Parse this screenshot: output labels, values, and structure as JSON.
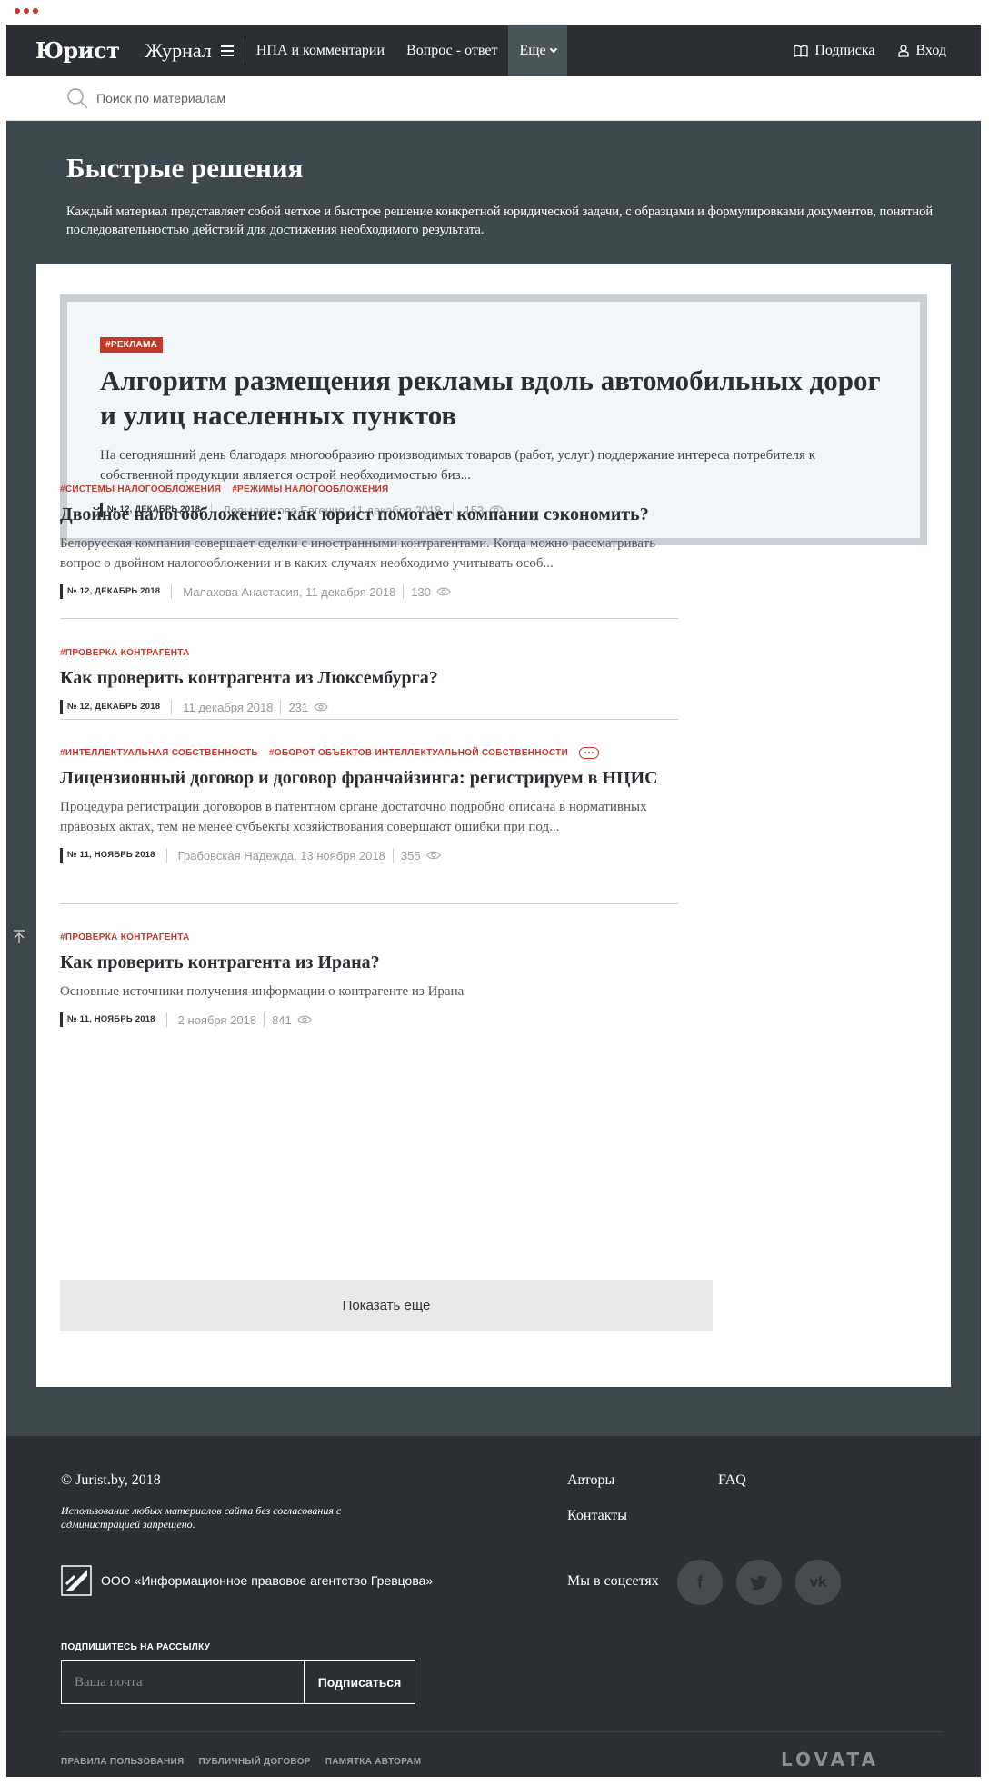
{
  "header": {
    "logo": "Юрист",
    "journal": "Журнал",
    "nav": [
      "НПА и комментарии",
      "Вопрос - ответ"
    ],
    "more": "Еще",
    "subscribe": "Подписка",
    "login": "Вход"
  },
  "search": {
    "placeholder": "Поиск по материалам"
  },
  "hero": {
    "title": "Быстрые решения",
    "description": "Каждый материал представляет собой четкое и быстрое решение конкретной юридической задачи, с образцами и формулировками документов, понятной последовательностью действий для достижения необходимого результата."
  },
  "featured": {
    "tag": "#РЕКЛАМА",
    "title": "Алгоритм размещения рекламы вдоль автомобильных дорог и улиц населенных пунктов",
    "description": "На сегодняшний день благодаря многообразию производимых товаров (работ, услуг) поддержание интереса потребителя к собственной продукции является острой необходимостью биз...",
    "issue": "№ 12, ДЕКАБРЬ 2018",
    "author_date": "Довыденкова Евгения, 11 декабря 2018",
    "views": "153"
  },
  "articles": [
    {
      "tags": [
        "#СИСТЕМЫ НАЛОГООБЛОЖЕНИЯ",
        "#РЕЖИМЫ НАЛОГООБЛОЖЕНИЯ"
      ],
      "title": "Двойное налогообложение: как юрист помогает компании сэкономить?",
      "description": "Белорусская компания совершает сделки с иностранными контрагентами. Когда можно рассматривать вопрос о двойном налогообложении и в каких случаях необходимо учитывать особ...",
      "issue": "№ 12, ДЕКАБРЬ 2018",
      "author_date": "Малахова Анастасия, 11 декабря 2018",
      "views": "130"
    },
    {
      "tags": [
        "#ПРОВЕРКА КОНТРАГЕНТА"
      ],
      "title": "Как проверить контрагента из Люксембурга?",
      "description": "",
      "issue": "№ 12, ДЕКАБРЬ 2018",
      "author_date": "11 декабря 2018",
      "views": "231"
    },
    {
      "tags": [
        "#ИНТЕЛЛЕКТУАЛЬНАЯ СОБСТВЕННОСТЬ",
        "#ОБОРОТ ОБЪЕКТОВ ИНТЕЛЛЕКТУАЛЬНОЙ СОБСТВЕННОСТИ"
      ],
      "title": "Лицензионный договор и договор франчайзинга: регистрируем в НЦИС",
      "description": "Процедура регистрации договоров в патентном органе достаточно подробно описана в нормативных правовых актах, тем не менее субъекты хозяйствования совершают ошибки при под...",
      "issue": "№ 11, НОЯБРЬ 2018",
      "author_date": "Грабовская Надежда, 13 ноября 2018",
      "views": "355"
    },
    {
      "tags": [
        "#ПРОВЕРКА КОНТРАГЕНТА"
      ],
      "title": "Как проверить контрагента из Ирана?",
      "description": "Основные источники получения информации о контрагенте из Ирана",
      "issue": "№ 11, НОЯБРЬ 2018",
      "author_date": "2 ноября 2018",
      "views": "841"
    }
  ],
  "show_more": "Показать еще",
  "footer": {
    "copyright": "© Jurist.by, 2018",
    "note": "Использование любых материалов сайта без согласования с администрацией запрещено.",
    "company": "ООО «Информационное правовое агентство Гревцова»",
    "links": [
      "Авторы",
      "FAQ",
      "Контакты"
    ],
    "social_label": "Мы в соцсетях",
    "newsletter_label": "ПОДПИШИТЕСЬ НА РАССЫЛКУ",
    "email_placeholder": "Ваша почта",
    "subscribe_button": "Подписаться",
    "bottom_links": [
      "ПРАВИЛА ПОЛЬЗОВАНИЯ",
      "ПУБЛИЧНЫЙ ДОГОВОР",
      "ПАМЯТКА АВТОРАМ"
    ],
    "developer": "LOVATA"
  },
  "colors": {
    "accent": "#c0392b",
    "dark": "#2b2f33",
    "hero_bg": "#3c474e"
  },
  "icons": [
    "search-icon",
    "menu-icon",
    "book-icon",
    "user-icon",
    "eye-icon",
    "scroll-top-icon",
    "facebook-icon",
    "twitter-icon",
    "vk-icon"
  ]
}
